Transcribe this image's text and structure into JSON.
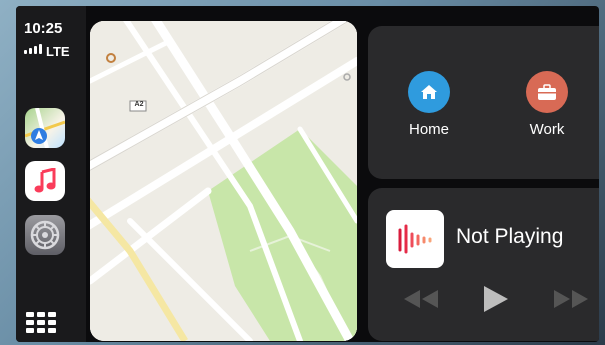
{
  "status": {
    "time": "10:25",
    "network": "LTE"
  },
  "dock": {
    "apps": [
      "maps-app-icon",
      "music-app-icon",
      "settings-app-icon"
    ],
    "launcher_icon": "grid-icon"
  },
  "destinations": {
    "home_label": "Home",
    "work_label": "Work"
  },
  "map": {
    "road_label": "A2"
  },
  "now_playing": {
    "title": "Not Playing"
  },
  "colors": {
    "home": "#2f9bde",
    "work": "#d86a55",
    "tile": "#2a2a2c",
    "park": "#c8e6a9"
  }
}
